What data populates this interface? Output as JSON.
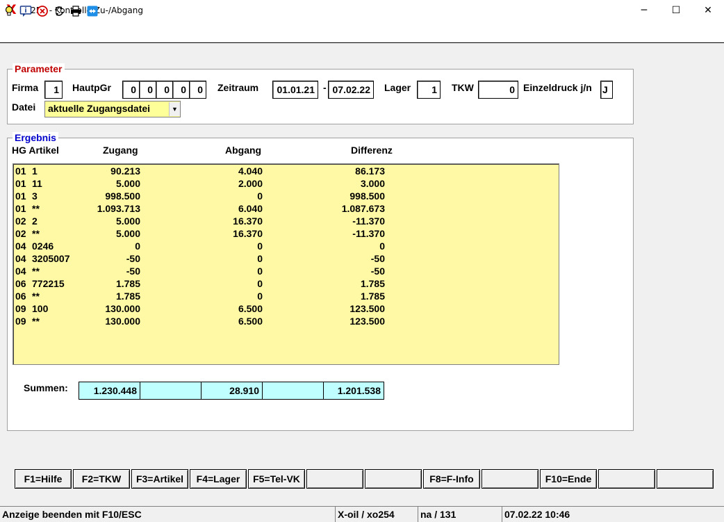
{
  "window": {
    "title": "xo254 - Kontrolle Zu-/Abgang",
    "logo": "X",
    "minimize": "─",
    "maximize": "☐",
    "close": "✕"
  },
  "toolbar": {
    "icons": [
      "lightbulb-icon",
      "info-icon",
      "cancel-icon",
      "refresh-icon",
      "printer-icon",
      "remote-icon"
    ]
  },
  "parameter": {
    "legend": "Parameter",
    "firma_label": "Firma",
    "firma_value": "1",
    "hauptgr_label": "HautpGr",
    "hauptgr_values": [
      "0",
      "0",
      "0",
      "0",
      "0"
    ],
    "zeitraum_label": "Zeitraum",
    "zeitraum_from": "01.01.21",
    "zeitraum_sep": "-",
    "zeitraum_to": "07.02.22",
    "lager_label": "Lager",
    "lager_value": "1",
    "tkw_label": "TKW",
    "tkw_value": "0",
    "einzeldruck_label": "Einzeldruck j/n",
    "einzeldruck_value": "J",
    "datei_label": "Datei",
    "datei_value": "aktuelle Zugangsdatei"
  },
  "ergebnis": {
    "legend": "Ergebnis",
    "col_hg": "HG Artikel",
    "col_zugang": "Zugang",
    "col_abgang": "Abgang",
    "col_differenz": "Differenz",
    "rows": [
      {
        "hg": "01",
        "artikel": "1",
        "zugang": "90.213",
        "abgang": "4.040",
        "differenz": "86.173"
      },
      {
        "hg": "01",
        "artikel": "11",
        "zugang": "5.000",
        "abgang": "2.000",
        "differenz": "3.000"
      },
      {
        "hg": "01",
        "artikel": "3",
        "zugang": "998.500",
        "abgang": "0",
        "differenz": "998.500"
      },
      {
        "hg": "01",
        "artikel": "**",
        "zugang": "1.093.713",
        "abgang": "6.040",
        "differenz": "1.087.673"
      },
      {
        "hg": "02",
        "artikel": "2",
        "zugang": "5.000",
        "abgang": "16.370",
        "differenz": "-11.370"
      },
      {
        "hg": "02",
        "artikel": "**",
        "zugang": "5.000",
        "abgang": "16.370",
        "differenz": "-11.370"
      },
      {
        "hg": "04",
        "artikel": "0246",
        "zugang": "0",
        "abgang": "0",
        "differenz": "0"
      },
      {
        "hg": "04",
        "artikel": "3205007",
        "zugang": "-50",
        "abgang": "0",
        "differenz": "-50"
      },
      {
        "hg": "04",
        "artikel": "**",
        "zugang": "-50",
        "abgang": "0",
        "differenz": "-50"
      },
      {
        "hg": "06",
        "artikel": "772215",
        "zugang": "1.785",
        "abgang": "0",
        "differenz": "1.785"
      },
      {
        "hg": "06",
        "artikel": "**",
        "zugang": "1.785",
        "abgang": "0",
        "differenz": "1.785"
      },
      {
        "hg": "09",
        "artikel": "100",
        "zugang": "130.000",
        "abgang": "6.500",
        "differenz": "123.500"
      },
      {
        "hg": "09",
        "artikel": "**",
        "zugang": "130.000",
        "abgang": "6.500",
        "differenz": "123.500"
      }
    ],
    "summen_label": "Summen:",
    "summen": [
      "1.230.448",
      "",
      "28.910",
      "",
      "1.201.538"
    ]
  },
  "fkeys": [
    "F1=Hilfe",
    "F2=TKW",
    "F3=Artikel",
    "F4=Lager",
    "F5=Tel-VK",
    "",
    "",
    "F8=F-Info",
    "",
    "F10=Ende",
    "",
    ""
  ],
  "status": {
    "message": "Anzeige beenden mit F10/ESC",
    "program": "X-oil / xo254",
    "user": "na / 131",
    "datetime": "07.02.22 10:46"
  },
  "colors": {
    "list_bg": "#fff9a6",
    "sum_bg": "#c0ffff",
    "param_legend": "#c00000",
    "result_legend": "#0000cc"
  }
}
